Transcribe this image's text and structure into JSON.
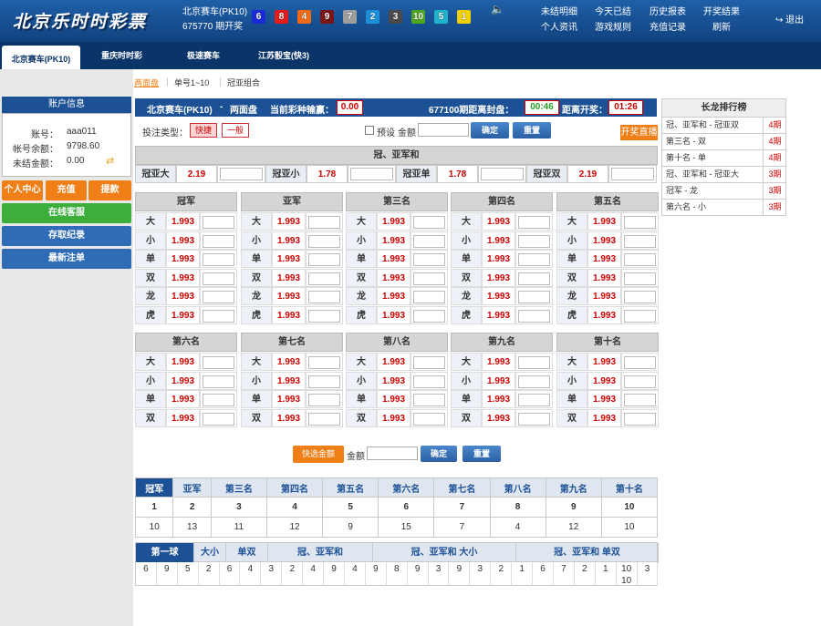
{
  "header": {
    "logo": "北京乐时时彩票",
    "game_name": "北京赛车(PK10)",
    "issue": "675770 期开奖",
    "balls": [
      {
        "num": "6",
        "color": "#1a2ad6"
      },
      {
        "num": "8",
        "color": "#e41b1b"
      },
      {
        "num": "4",
        "color": "#ef6a14"
      },
      {
        "num": "9",
        "color": "#7b1616"
      },
      {
        "num": "7",
        "color": "#9e9e9e"
      },
      {
        "num": "2",
        "color": "#1d8fd8"
      },
      {
        "num": "3",
        "color": "#4a4a4a"
      },
      {
        "num": "10",
        "color": "#4ea61f"
      },
      {
        "num": "5",
        "color": "#1fb2c9"
      },
      {
        "num": "1",
        "color": "#f0d000"
      }
    ],
    "nav": [
      [
        "未结明细",
        "个人资讯"
      ],
      [
        "今天已结",
        "游戏规则"
      ],
      [
        "历史报表",
        "充值记录"
      ],
      [
        "开奖结果",
        "刷新"
      ]
    ],
    "logout": "退出",
    "speaker_icon": "speaker-icon"
  },
  "game_tabs": [
    "北京赛车(PK10)",
    "重庆时时彩",
    "极速赛车",
    "江苏骰宝(快3)"
  ],
  "sidebar": {
    "title": "账户信息",
    "account_label": "账号：",
    "account": "aaa011",
    "balance_label": "帐号余额：",
    "balance": "9798.60",
    "unsettled_label": "未结金额：",
    "unsettled": "0.00",
    "buttons": [
      "个人中心",
      "充值",
      "提款"
    ],
    "service": "在线客服",
    "deposit_records": "存取纪录",
    "latest": "最新注单"
  },
  "subtabs": [
    "两面盘",
    "单号1~10",
    "冠亚组合"
  ],
  "main_bar": {
    "game": "北京赛车(PK10)",
    "sep": "-",
    "mode": "两面盘",
    "loss_label": "当前彩种输赢：",
    "loss": "0.00",
    "issue_text": "677100期距离封盘：",
    "close_time": "00:46",
    "open_label": "距离开奖：",
    "open_time": "01:26"
  },
  "controls": {
    "type_label": "投注类型：",
    "fast": "快捷",
    "normal": "一般",
    "preset": "预设",
    "amount": "金额",
    "confirm": "确定",
    "reset": "重置",
    "live": "开奖直播"
  },
  "gyh": {
    "title": "冠、亚军和",
    "items": [
      {
        "label": "冠亚大",
        "odds": "2.19"
      },
      {
        "label": "冠亚小",
        "odds": "1.78"
      },
      {
        "label": "冠亚单",
        "odds": "1.78"
      },
      {
        "label": "冠亚双",
        "odds": "2.19"
      }
    ]
  },
  "ranks_top": [
    {
      "title": "冠军",
      "rows": [
        "大",
        "小",
        "单",
        "双",
        "龙",
        "虎"
      ],
      "odds": "1.993"
    },
    {
      "title": "亚军",
      "rows": [
        "大",
        "小",
        "单",
        "双",
        "龙",
        "虎"
      ],
      "odds": "1.993"
    },
    {
      "title": "第三名",
      "rows": [
        "大",
        "小",
        "单",
        "双",
        "龙",
        "虎"
      ],
      "odds": "1.993"
    },
    {
      "title": "第四名",
      "rows": [
        "大",
        "小",
        "单",
        "双",
        "龙",
        "虎"
      ],
      "odds": "1.993"
    },
    {
      "title": "第五名",
      "rows": [
        "大",
        "小",
        "单",
        "双",
        "龙",
        "虎"
      ],
      "odds": "1.993"
    }
  ],
  "ranks_bottom": [
    {
      "title": "第六名",
      "rows": [
        "大",
        "小",
        "单",
        "双"
      ],
      "odds": "1.993"
    },
    {
      "title": "第七名",
      "rows": [
        "大",
        "小",
        "单",
        "双"
      ],
      "odds": "1.993"
    },
    {
      "title": "第八名",
      "rows": [
        "大",
        "小",
        "单",
        "双"
      ],
      "odds": "1.993"
    },
    {
      "title": "第九名",
      "rows": [
        "大",
        "小",
        "单",
        "双"
      ],
      "odds": "1.993"
    },
    {
      "title": "第十名",
      "rows": [
        "大",
        "小",
        "单",
        "双"
      ],
      "odds": "1.993"
    }
  ],
  "bottom_controls": {
    "select_all": "快选金额",
    "amount": "金额",
    "confirm": "确定",
    "reset": "重置"
  },
  "stats": {
    "headers": [
      "冠军",
      "亚军",
      "第三名",
      "第四名",
      "第五名",
      "第六名",
      "第七名",
      "第八名",
      "第九名",
      "第十名"
    ],
    "row1": [
      "1",
      "2",
      "3",
      "4",
      "5",
      "6",
      "7",
      "8",
      "9",
      "10"
    ],
    "row2": [
      "10",
      "13",
      "11",
      "12",
      "9",
      "15",
      "7",
      "4",
      "12",
      "10"
    ]
  },
  "road": {
    "tabs": [
      "第一球",
      "大小",
      "单双",
      "冠、亚军和",
      "冠、亚军和 大小",
      "冠、亚军和 单双"
    ],
    "cols": [
      [
        "6"
      ],
      [
        "9"
      ],
      [
        "5"
      ],
      [
        "2"
      ],
      [
        "6"
      ],
      [
        "4"
      ],
      [
        "3"
      ],
      [
        "2"
      ],
      [
        "4"
      ],
      [
        "9"
      ],
      [
        "4"
      ],
      [
        "9"
      ],
      [
        "8"
      ],
      [
        "9"
      ],
      [
        "3"
      ],
      [
        "9"
      ],
      [
        "3"
      ],
      [
        "2"
      ],
      [
        "1"
      ],
      [
        "6"
      ],
      [
        "7"
      ],
      [
        "2"
      ],
      [
        "1"
      ],
      [
        "10",
        "10"
      ],
      [
        "3"
      ]
    ]
  },
  "long_list": {
    "title": "长龙排行榜",
    "items": [
      {
        "name": "冠、亚军和 - 冠亚双",
        "periods": "4期"
      },
      {
        "name": "第三名 - 双",
        "periods": "4期"
      },
      {
        "name": "第十名 - 单",
        "periods": "4期"
      },
      {
        "name": "冠、亚军和 - 冠亚大",
        "periods": "3期"
      },
      {
        "name": "冠军 - 龙",
        "periods": "3期"
      },
      {
        "name": "第六名 - 小",
        "periods": "3期"
      }
    ]
  }
}
